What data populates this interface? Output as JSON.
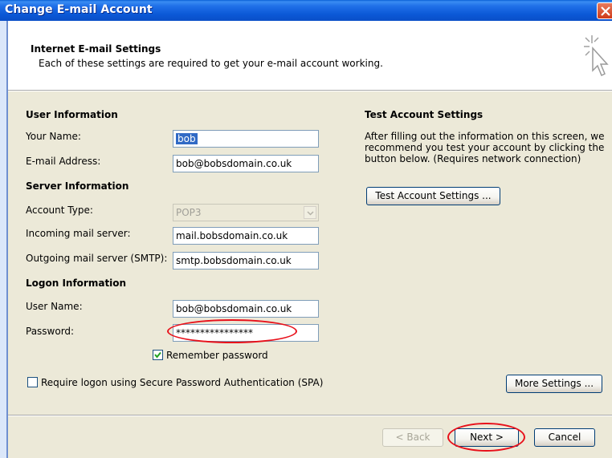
{
  "window": {
    "title": "Change E-mail Account"
  },
  "header": {
    "title": "Internet E-mail Settings",
    "subtitle": "Each of these settings are required to get your e-mail account working."
  },
  "user_info": {
    "title": "User Information",
    "name_label": "Your Name:",
    "name_value": "bob",
    "email_label": "E-mail Address:",
    "email_value": "bob@bobsdomain.co.uk"
  },
  "server_info": {
    "title": "Server Information",
    "account_type_label": "Account Type:",
    "account_type_value": "POP3",
    "incoming_label": "Incoming mail server:",
    "incoming_value": "mail.bobsdomain.co.uk",
    "outgoing_label": "Outgoing mail server (SMTP):",
    "outgoing_value": "smtp.bobsdomain.co.uk"
  },
  "logon_info": {
    "title": "Logon Information",
    "username_label": "User Name:",
    "username_value": "bob@bobsdomain.co.uk",
    "password_label": "Password:",
    "password_value": "****************",
    "remember_label": "Remember password",
    "remember_checked": true,
    "spa_label": "Require logon using Secure Password Authentication (SPA)",
    "spa_checked": false
  },
  "test": {
    "title": "Test Account Settings",
    "description_line1": "After filling out the information on this screen, we",
    "description_line2": "recommend you test your account by clicking the",
    "description_line3": "button below. (Requires network connection)",
    "button_label": "Test Account Settings ..."
  },
  "buttons": {
    "more_settings": "More Settings ...",
    "back": "< Back",
    "next": "Next >",
    "cancel": "Cancel"
  },
  "colors": {
    "title_bar": "#0b58d6",
    "dialog_bg": "#ece9d8",
    "highlight_oval": "#e8101a"
  }
}
